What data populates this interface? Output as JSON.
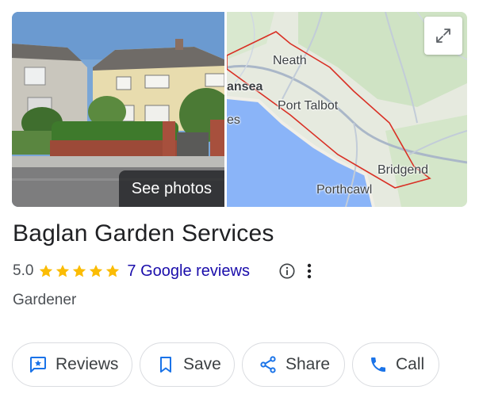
{
  "photo": {
    "see_photos_label": "See photos"
  },
  "map": {
    "labels": {
      "neath": "Neath",
      "swansea": "ansea",
      "swansea_suffix": "es",
      "port_talbot": "Port Talbot",
      "bridgend": "Bridgend",
      "porthcawl": "Porthcawl"
    },
    "expand_icon": "expand-icon",
    "route_color": "#d93025"
  },
  "business": {
    "name": "Baglan Garden Services",
    "rating": "5.0",
    "stars": 5,
    "reviews_link": "7 Google reviews",
    "category": "Gardener",
    "info_icon": "info-icon",
    "more_icon": "more-vert-icon"
  },
  "actions": [
    {
      "label": "Reviews",
      "icon": "review-icon"
    },
    {
      "label": "Save",
      "icon": "bookmark-icon"
    },
    {
      "label": "Share",
      "icon": "share-icon"
    },
    {
      "label": "Call",
      "icon": "phone-icon"
    }
  ],
  "colors": {
    "star": "#fbbc04",
    "link": "#1a0dab",
    "action_icon": "#1a73e8"
  }
}
